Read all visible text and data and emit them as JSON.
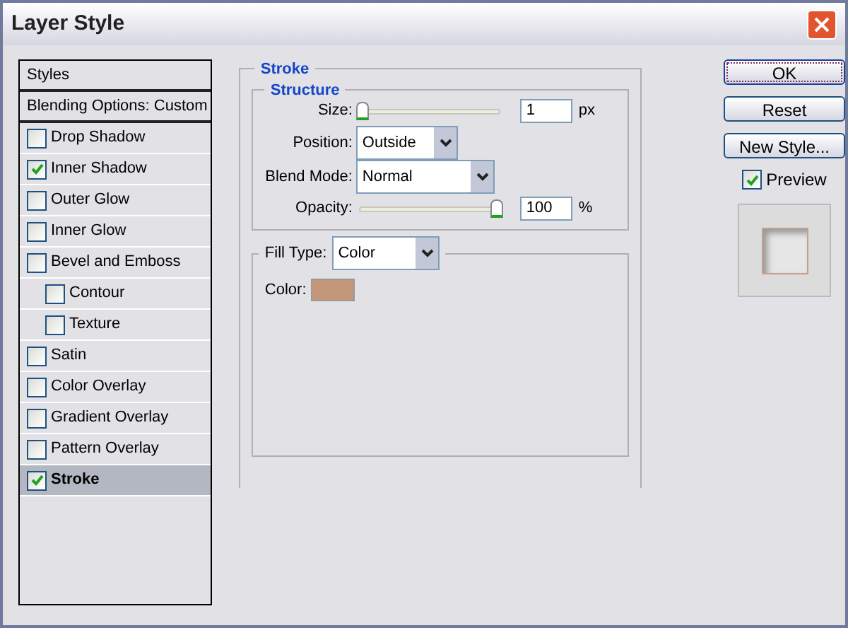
{
  "window": {
    "title": "Layer Style"
  },
  "styles_list": [
    {
      "kind": "header",
      "label": "Styles",
      "selected": false
    },
    {
      "kind": "header",
      "label": "Blending Options: Custom",
      "selected": false
    },
    {
      "kind": "effect",
      "label": "Drop Shadow",
      "checked": false,
      "selected": false
    },
    {
      "kind": "effect",
      "label": "Inner Shadow",
      "checked": true,
      "selected": false
    },
    {
      "kind": "effect",
      "label": "Outer Glow",
      "checked": false,
      "selected": false
    },
    {
      "kind": "effect",
      "label": "Inner Glow",
      "checked": false,
      "selected": false
    },
    {
      "kind": "effect",
      "label": "Bevel and Emboss",
      "checked": false,
      "selected": false,
      "children": [
        {
          "kind": "effect",
          "label": "Contour",
          "checked": false,
          "selected": false
        },
        {
          "kind": "effect",
          "label": "Texture",
          "checked": false,
          "selected": false
        }
      ]
    },
    {
      "kind": "effect",
      "label": "Satin",
      "checked": false,
      "selected": false
    },
    {
      "kind": "effect",
      "label": "Color Overlay",
      "checked": false,
      "selected": false
    },
    {
      "kind": "effect",
      "label": "Gradient Overlay",
      "checked": false,
      "selected": false
    },
    {
      "kind": "effect",
      "label": "Pattern Overlay",
      "checked": false,
      "selected": false
    },
    {
      "kind": "effect",
      "label": "Stroke",
      "checked": true,
      "selected": true
    }
  ],
  "stroke": {
    "title": "Stroke",
    "structure": {
      "title": "Structure",
      "size": {
        "label": "Size:",
        "level": 0.0,
        "value": "1",
        "unit": "px"
      },
      "position": {
        "label": "Position:",
        "value": "Outside"
      },
      "blend_mode": {
        "label": "Blend Mode:",
        "value": "Normal"
      },
      "opacity": {
        "label": "Opacity:",
        "level": 1.0,
        "value": "100",
        "unit": "%"
      }
    },
    "fill_type": {
      "label": "Fill Type:",
      "value": "Color"
    },
    "color": {
      "label": "Color:"
    }
  },
  "buttons": [
    {
      "label": "OK",
      "default": true
    },
    {
      "label": "Reset",
      "default": false
    },
    {
      "label": "New Style...",
      "default": false
    }
  ],
  "preview": {
    "label": "Preview",
    "checked": true
  }
}
